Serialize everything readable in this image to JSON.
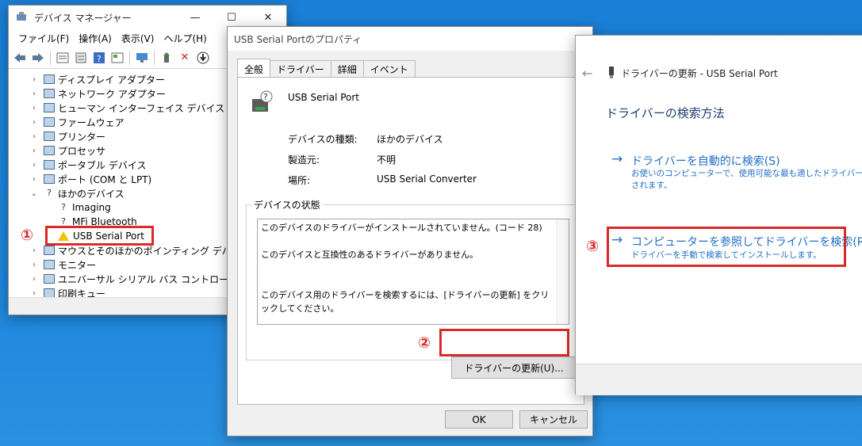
{
  "device_manager": {
    "title": "デバイス マネージャー",
    "minimize": "—",
    "maximize": "☐",
    "close": "✕",
    "menu": [
      "ファイル(F)",
      "操作(A)",
      "表示(V)",
      "ヘルプ(H)"
    ],
    "tree": [
      {
        "label": "ディスプレイ アダプター",
        "expander": "›"
      },
      {
        "label": "ネットワーク アダプター",
        "expander": "›"
      },
      {
        "label": "ヒューマン インターフェイス デバイス",
        "expander": "›"
      },
      {
        "label": "ファームウェア",
        "expander": "›"
      },
      {
        "label": "プリンター",
        "expander": "›"
      },
      {
        "label": "プロセッサ",
        "expander": "›"
      },
      {
        "label": "ポータブル デバイス",
        "expander": "›"
      },
      {
        "label": "ポート (COM と LPT)",
        "expander": "›"
      },
      {
        "label": "ほかのデバイス",
        "expander": "⌄"
      },
      {
        "label": "Imaging",
        "expander": ""
      },
      {
        "label": "MFi Bluetooth",
        "expander": ""
      },
      {
        "label": "USB Serial Port",
        "expander": ""
      },
      {
        "label": "マウスとそのほかのポインティング デバイス",
        "expander": "›"
      },
      {
        "label": "モニター",
        "expander": "›"
      },
      {
        "label": "ユニバーサル シリアル バス コントローラー",
        "expander": "›"
      },
      {
        "label": "印刷キュー",
        "expander": "›"
      }
    ]
  },
  "properties": {
    "title": "USB Serial Portのプロパティ",
    "tabs": [
      "全般",
      "ドライバー",
      "詳細",
      "イベント"
    ],
    "device_name": "USB Serial Port",
    "fields": [
      {
        "label": "デバイスの種類:",
        "value": "ほかのデバイス"
      },
      {
        "label": "製造元:",
        "value": "不明"
      },
      {
        "label": "場所:",
        "value": "USB Serial Converter"
      }
    ],
    "status_legend": "デバイスの状態",
    "status_lines": [
      "このデバイスのドライバーがインストールされていません。(コード 28)",
      "このデバイスと互換性のあるドライバーがありません。",
      "このデバイス用のドライバーを検索するには、[ドライバーの更新] をクリックしてください。"
    ],
    "update_button": "ドライバーの更新(U)...",
    "ok_button": "OK",
    "cancel_button": "キャンセル"
  },
  "update_driver": {
    "back": "←",
    "title": "ドライバーの更新 - USB Serial Port",
    "heading": "ドライバーの検索方法",
    "options": [
      {
        "arrow": "→",
        "title": "ドライバーを自動的に検索(S)",
        "desc_1": "お使いのコンピューターで、使用可能な最も適したドライバーが検",
        "desc_2": "されます。"
      },
      {
        "arrow": "→",
        "title": "コンピューターを参照してドライバーを検索(R)",
        "desc_1": "ドライバーを手動で検索してインストールします。",
        "desc_2": ""
      }
    ]
  },
  "annotations": {
    "step1": "①",
    "step2": "②",
    "step3": "③",
    "color": "#d92a2a"
  }
}
